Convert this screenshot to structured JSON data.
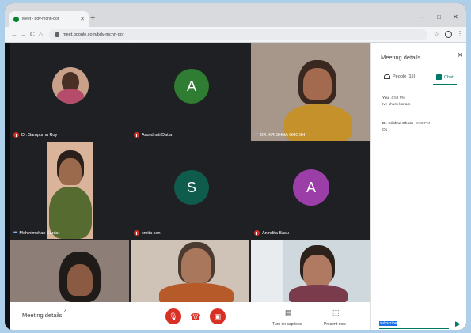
{
  "browser": {
    "tab_title": "Meet - bdv-mcnn-qor",
    "new_tab": "+",
    "url": "meet.google.com/bdv-mcnn-qor",
    "minimize": "–",
    "maximize": "□",
    "close": "✕"
  },
  "participants": [
    {
      "name": "Dr. Sampurna Roy",
      "type": "photo",
      "muted": true
    },
    {
      "name": "Arundhati Datta",
      "type": "avatar",
      "initial": "A",
      "color": "#2e7d32",
      "muted": true
    },
    {
      "name": "DR. KRISHNA GHOSH",
      "type": "video",
      "muted": false
    },
    {
      "name": "Mohinimohan Sardar",
      "type": "video",
      "muted": false
    },
    {
      "name": "smita sen",
      "type": "avatar",
      "initial": "S",
      "color": "#0f5c4c",
      "muted": true
    },
    {
      "name": "Anindita Basu",
      "type": "avatar",
      "initial": "A",
      "color": "#9c3ea8",
      "muted": true
    },
    {
      "name": "",
      "type": "video",
      "muted": false
    },
    {
      "name": "",
      "type": "video",
      "muted": false
    },
    {
      "name": "",
      "type": "video",
      "muted": false
    }
  ],
  "controls": {
    "meeting_details": "Meeting details",
    "captions_label": "Turn on captions",
    "present_label": "Present now"
  },
  "panel": {
    "title": "Meeting details",
    "people_tab": "People (15)",
    "chat_tab": "Chat",
    "messages": [
      {
        "sender": "You",
        "time": "4:53 PM",
        "text": "Ive shuru korlam"
      },
      {
        "sender": "Dr. Krishna Ghosh",
        "time": "4:53 PM",
        "text": "Ok"
      }
    ],
    "input_value": "subscribe"
  },
  "colors": {
    "accent": "#00796b",
    "danger": "#d93025",
    "page_bg": "#aecfe9"
  }
}
